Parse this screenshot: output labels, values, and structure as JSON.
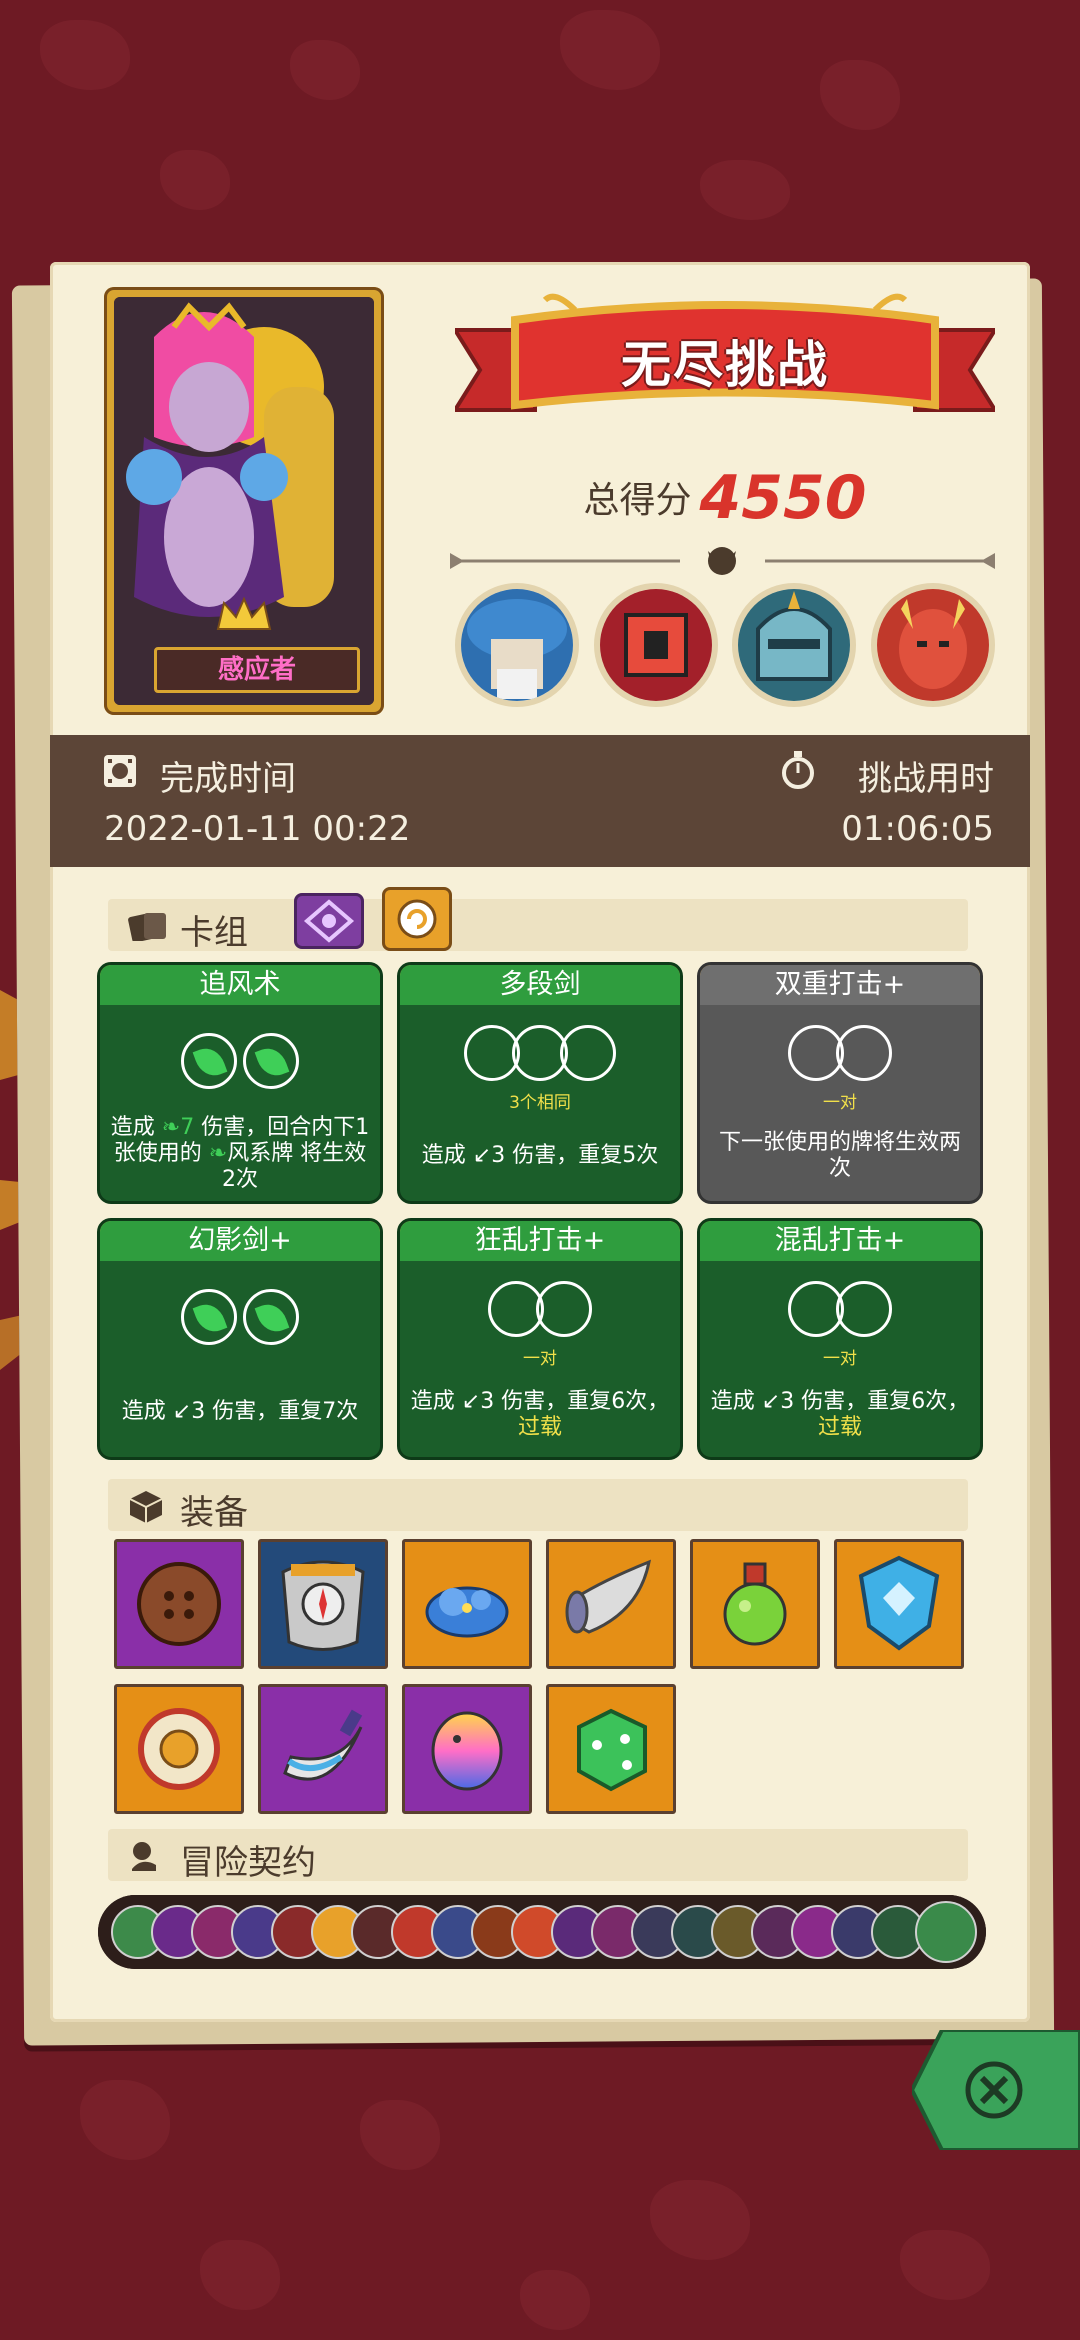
{
  "hero": {
    "name": "感应者"
  },
  "mode": {
    "title": "无尽挑战"
  },
  "score": {
    "label": "总得分",
    "value": "4550"
  },
  "bosses": [
    {
      "name": "mushroom-boss-portrait",
      "color": "#2e6fb0"
    },
    {
      "name": "chest-boss-portrait",
      "color": "#a3202a"
    },
    {
      "name": "knight-boss-portrait",
      "color": "#2f6a7a"
    },
    {
      "name": "demon-boss-portrait",
      "color": "#c0392b"
    }
  ],
  "times": {
    "finish_label": "完成时间",
    "finish_value": "2022-01-11 00:22",
    "duration_label": "挑战用时",
    "duration_value": "01:06:05"
  },
  "deck": {
    "label": "卡组",
    "filter_icons": [
      "eye-rune-icon",
      "spiral-badge-icon"
    ],
    "cards": [
      {
        "title": "追风术",
        "color": "green",
        "desc_a": "造成",
        "desc_num": "7",
        "desc_b": "伤害，回合内下1张使用的",
        "desc_c": "风系牌 将生效2次"
      },
      {
        "title": "多段剑",
        "color": "green",
        "sub": "3个相同",
        "desc": "造成 ↙3 伤害，重复5次"
      },
      {
        "title": "双重打击+",
        "color": "gray",
        "sub": "一对",
        "desc": "下一张使用的牌将生效两次"
      },
      {
        "title": "幻影剑+",
        "color": "green",
        "desc": "造成 ↙3 伤害，重复7次"
      },
      {
        "title": "狂乱打击+",
        "color": "green",
        "sub": "一对",
        "desc": "造成 ↙3 伤害，重复6次，",
        "extra": "过载"
      },
      {
        "title": "混乱打击+",
        "color": "green",
        "sub": "一对",
        "desc": "造成 ↙3 伤害，重复6次，",
        "extra": "过载"
      }
    ]
  },
  "equipment": {
    "label": "装备",
    "items": [
      {
        "name": "wooden-button-shield-icon",
        "bg": "purple"
      },
      {
        "name": "compass-armor-icon",
        "bg": "blue"
      },
      {
        "name": "blue-slime-icon",
        "bg": "orange"
      },
      {
        "name": "horn-cornucopia-icon",
        "bg": "orange"
      },
      {
        "name": "green-potion-icon",
        "bg": "orange"
      },
      {
        "name": "crystal-shield-icon",
        "bg": "orange"
      },
      {
        "name": "gold-ring-icon",
        "bg": "orange"
      },
      {
        "name": "curved-dagger-icon",
        "bg": "purple"
      },
      {
        "name": "rainbow-egg-icon",
        "bg": "purple"
      },
      {
        "name": "green-dice-icon",
        "bg": "orange"
      }
    ]
  },
  "contracts": {
    "label": "冒险契约"
  }
}
